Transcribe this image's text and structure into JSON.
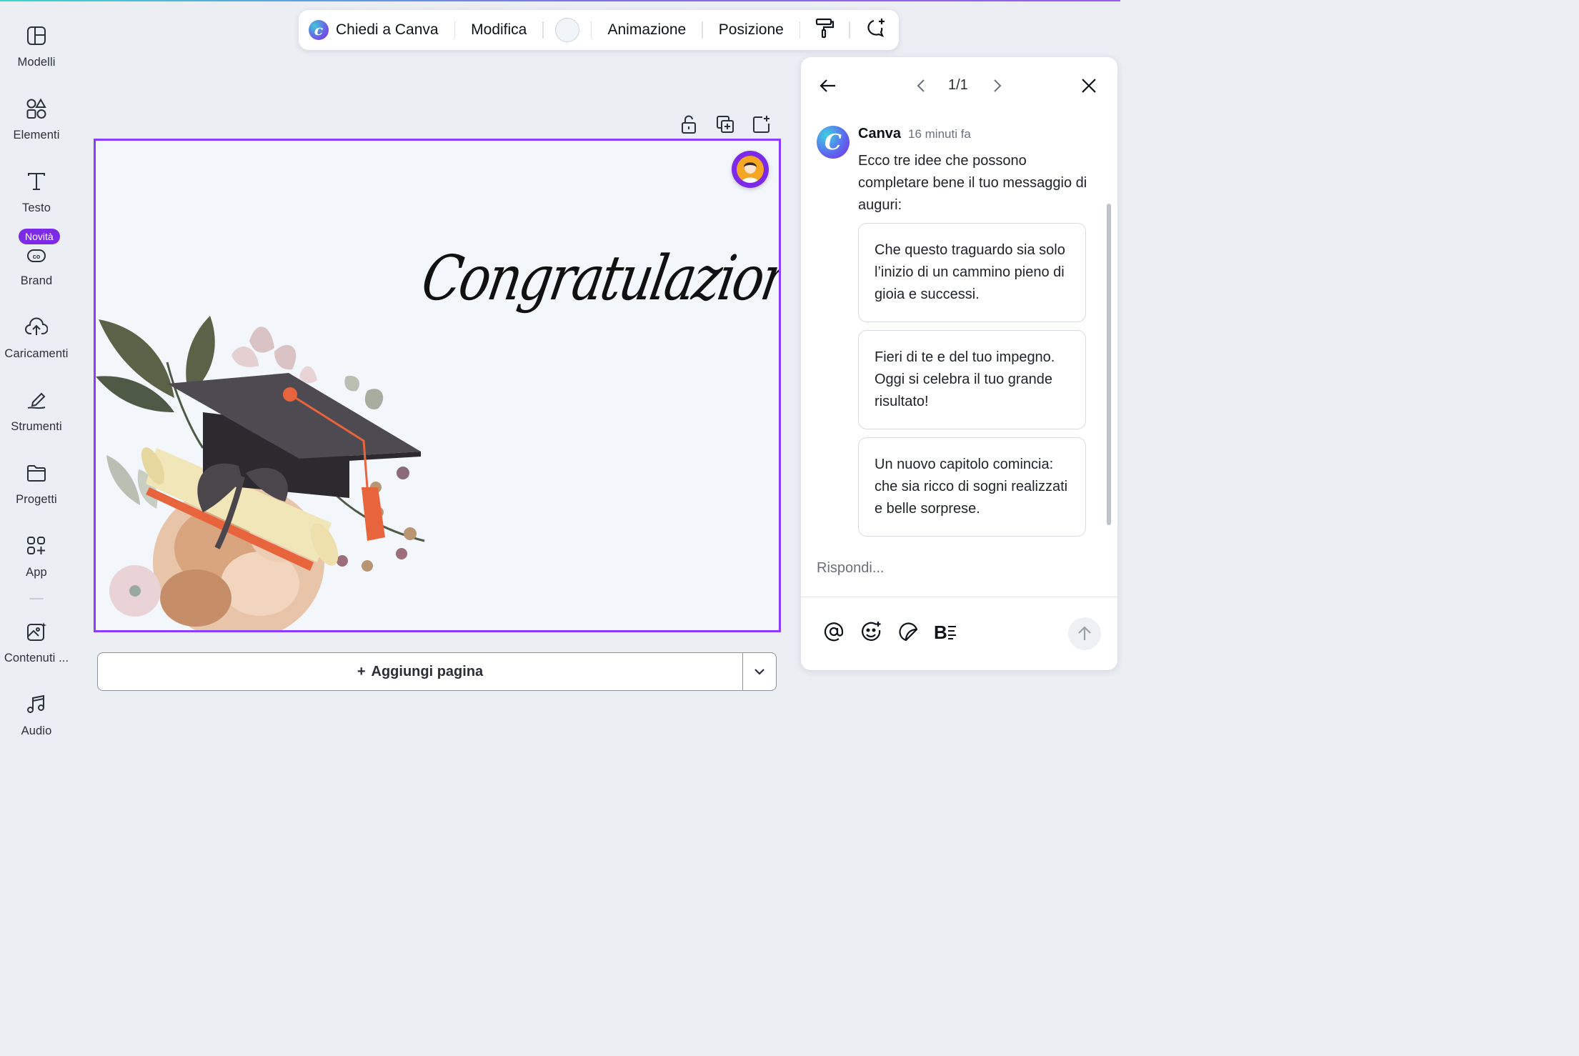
{
  "sidebar": {
    "items": [
      {
        "label": "Modelli",
        "icon": "templates-icon"
      },
      {
        "label": "Elementi",
        "icon": "elements-icon"
      },
      {
        "label": "Testo",
        "icon": "text-icon"
      },
      {
        "label": "Brand",
        "icon": "brand-icon"
      },
      {
        "label": "Caricamenti",
        "icon": "upload-cloud-icon"
      },
      {
        "label": "Strumenti",
        "icon": "draw-tool-icon"
      },
      {
        "label": "Progetti",
        "icon": "folder-icon"
      },
      {
        "label": "App",
        "icon": "apps-grid-icon"
      },
      {
        "label": "Contenuti ...",
        "icon": "magic-media-icon"
      },
      {
        "label": "Audio",
        "icon": "music-note-icon"
      }
    ],
    "badge": "Novità"
  },
  "toolbar": {
    "ask_canva": "Chiedi a Canva",
    "edit": "Modifica",
    "color_value": "#f1f4f8",
    "animation": "Animazione",
    "position": "Posizione"
  },
  "canvas": {
    "heading": "Congratulazioni!",
    "background": "#f3f6fa",
    "selection_color": "#8b3dff"
  },
  "add_page": {
    "label": "Aggiungi pagina",
    "plus": "+"
  },
  "comment_panel": {
    "pager": "1/1",
    "author": "Canva",
    "time": "16 minuti fa",
    "avatar_letter": "C",
    "message": "Ecco tre idee che possono completare bene il tuo messaggio di auguri:",
    "suggestions": [
      "Che questo traguardo sia solo l’inizio di un cammino pieno di gioia e successi.",
      "Fieri di te e del tuo impegno. Oggi si celebra il tuo grande risultato!",
      "Un nuovo capitolo comincia: che sia ricco di sogni realizzati e belle sorprese."
    ],
    "reply_placeholder": "Rispondi..."
  },
  "colors": {
    "accent": "#7d2ae8",
    "selection": "#8b3dff"
  }
}
